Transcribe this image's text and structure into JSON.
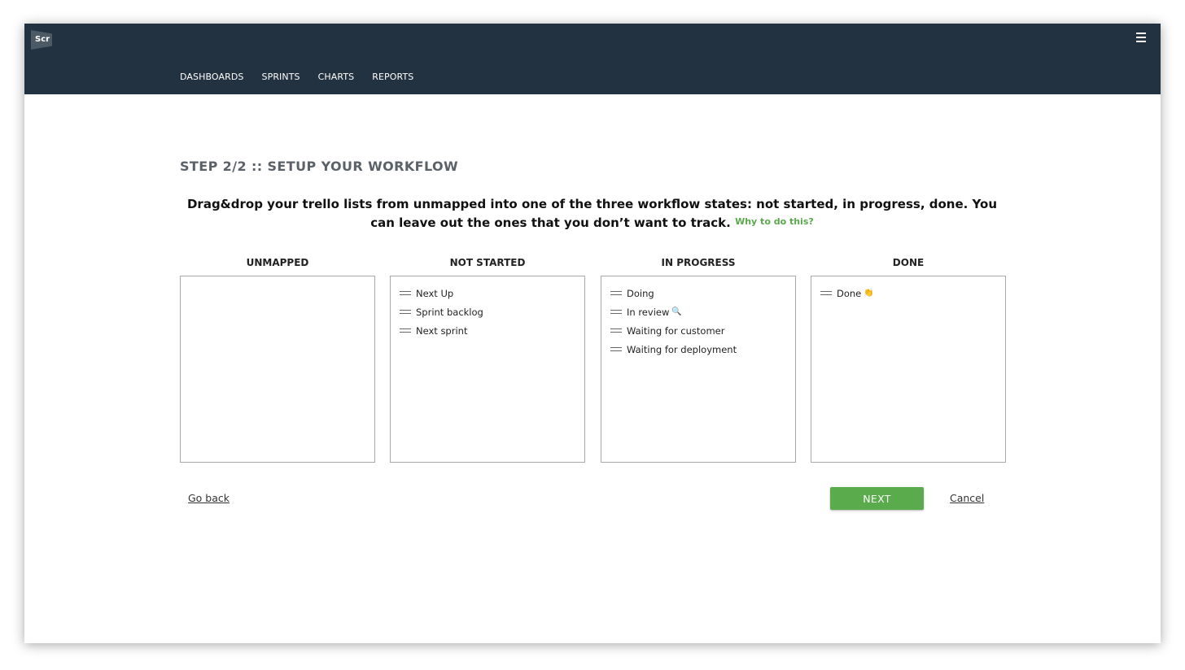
{
  "app": {
    "logo_text": "Scr"
  },
  "nav": {
    "items": [
      {
        "label": "DASHBOARDS"
      },
      {
        "label": "SPRINTS"
      },
      {
        "label": "CHARTS"
      },
      {
        "label": "REPORTS"
      }
    ]
  },
  "page": {
    "step_title": "STEP 2/2 :: SETUP YOUR WORKFLOW",
    "instructions": "Drag&drop your trello lists from unmapped into one of the three workflow states: not started, in progress, done. You can leave out the ones that you don’t want to track.",
    "why_link": "Why to do this?"
  },
  "columns": [
    {
      "title": "UNMAPPED",
      "cards": []
    },
    {
      "title": "NOT STARTED",
      "cards": [
        {
          "label": "Next Up"
        },
        {
          "label": "Sprint backlog"
        },
        {
          "label": "Next sprint"
        }
      ]
    },
    {
      "title": "IN PROGRESS",
      "cards": [
        {
          "label": "Doing"
        },
        {
          "label": "In review",
          "emoji": "🔍"
        },
        {
          "label": "Waiting for customer"
        },
        {
          "label": "Waiting for deployment"
        }
      ]
    },
    {
      "title": "DONE",
      "cards": [
        {
          "label": "Done",
          "emoji": "👏"
        }
      ]
    }
  ],
  "actions": {
    "go_back": "Go back",
    "next": "NEXT",
    "cancel": "Cancel"
  },
  "colors": {
    "topbar": "#233241",
    "accent_green": "#5aab4b",
    "link_green": "#5aa84d"
  }
}
